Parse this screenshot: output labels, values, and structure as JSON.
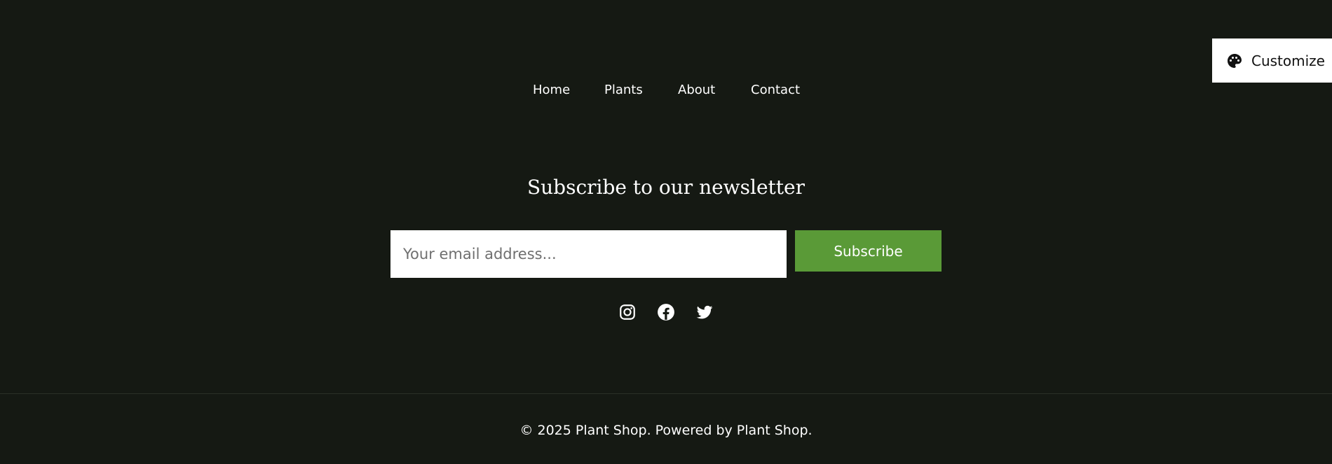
{
  "nav": {
    "items": [
      {
        "label": "Home"
      },
      {
        "label": "Plants"
      },
      {
        "label": "About"
      },
      {
        "label": "Contact"
      }
    ]
  },
  "newsletter": {
    "title": "Subscribe to our newsletter",
    "email_value": "",
    "email_placeholder": "Your email address...",
    "subscribe_label": "Subscribe"
  },
  "social": {
    "icons": [
      "instagram-icon",
      "facebook-icon",
      "twitter-icon"
    ]
  },
  "footer": {
    "copyright": "© 2025 Plant Shop. Powered by Plant Shop."
  },
  "customize": {
    "label": "Customize",
    "icon": "palette-icon"
  },
  "colors": {
    "background": "#151913",
    "accent": "#5a9a37",
    "text": "#ffffff"
  }
}
